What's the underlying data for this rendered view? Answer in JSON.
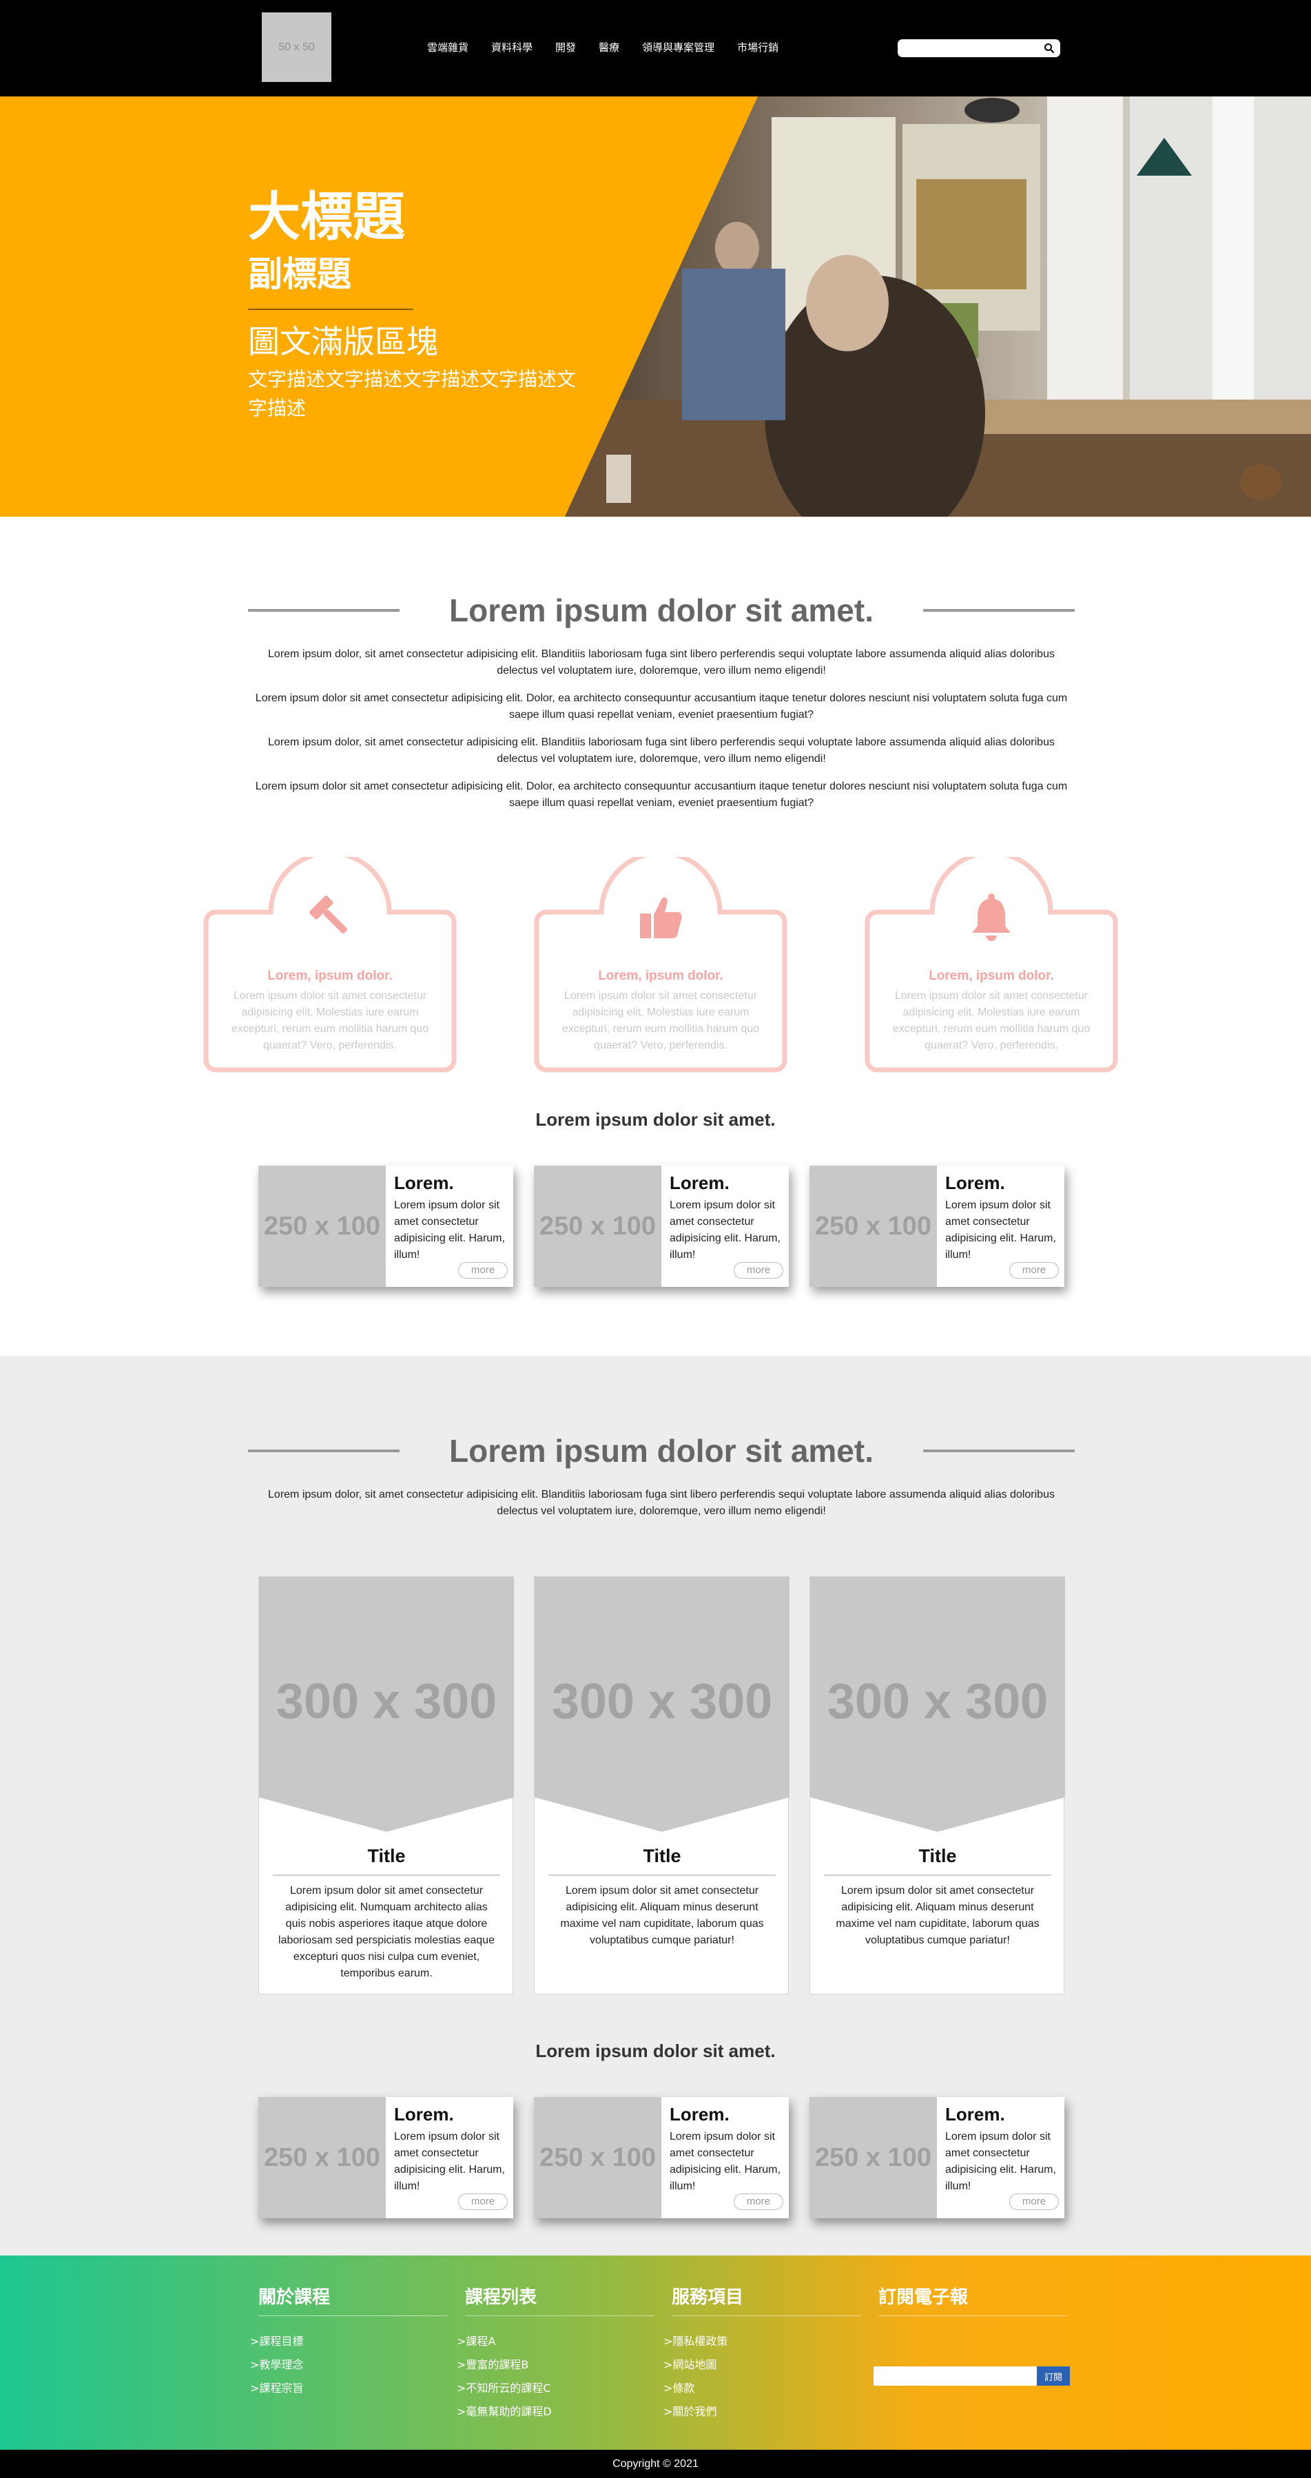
{
  "header": {
    "logo_text": "50 x 50",
    "nav": [
      "雲端雜貨",
      "資料科學",
      "開發",
      "醫療",
      "領導與專案管理",
      "市場行銷"
    ],
    "search_placeholder": ""
  },
  "hero": {
    "title": "大標題",
    "subtitle": "副標題",
    "heading": "圖文滿版區塊",
    "description": "文字描述文字描述文字描述文字描述文字描述"
  },
  "section1": {
    "title": "Lorem ipsum dolor sit amet.",
    "paragraphs": [
      "Lorem ipsum dolor, sit amet consectetur adipisicing elit. Blanditiis laboriosam fuga sint libero perferendis sequi voluptate labore assumenda aliquid alias doloribus delectus vel voluptatem iure, doloremque, vero illum nemo eligendi!",
      "Lorem ipsum dolor sit amet consectetur adipisicing elit. Dolor, ea architecto consequuntur accusantium itaque tenetur dolores nesciunt nisi voluptatem soluta fuga cum saepe illum quasi repellat veniam, eveniet praesentium fugiat?",
      "Lorem ipsum dolor, sit amet consectetur adipisicing elit. Blanditiis laboriosam fuga sint libero perferendis sequi voluptate labore assumenda aliquid alias doloribus delectus vel voluptatem iure, doloremque, vero illum nemo eligendi!",
      "Lorem ipsum dolor sit amet consectetur adipisicing elit. Dolor, ea architecto consequuntur accusantium itaque tenetur dolores nesciunt nisi voluptatem soluta fuga cum saepe illum quasi repellat veniam, eveniet praesentium fugiat?"
    ],
    "features": [
      {
        "icon": "gavel-icon",
        "title": "Lorem, ipsum dolor.",
        "desc": "Lorem ipsum dolor sit amet consectetur adipisicing elit. Molestias iure earum excepturi, rerum eum mollitia harum quo quaerat? Vero, perferendis."
      },
      {
        "icon": "thumbs-up-icon",
        "title": "Lorem, ipsum dolor.",
        "desc": "Lorem ipsum dolor sit amet consectetur adipisicing elit. Molestias iure earum excepturi, rerum eum mollitia harum quo quaerat? Vero, perferendis."
      },
      {
        "icon": "bell-icon",
        "title": "Lorem, ipsum dolor.",
        "desc": "Lorem ipsum dolor sit amet consectetur adipisicing elit. Molestias iure earum excepturi, rerum eum mollitia harum quo quaerat? Vero, perferendis."
      }
    ],
    "cards_heading": "Lorem ipsum dolor sit amet.",
    "cards": [
      {
        "thumb": "250 x 100",
        "title": "Lorem.",
        "desc": "Lorem ipsum dolor sit amet consectetur adipisicing elit. Harum, illum!",
        "more": "more"
      },
      {
        "thumb": "250 x 100",
        "title": "Lorem.",
        "desc": "Lorem ipsum dolor sit amet consectetur adipisicing elit. Harum, illum!",
        "more": "more"
      },
      {
        "thumb": "250 x 100",
        "title": "Lorem.",
        "desc": "Lorem ipsum dolor sit amet consectetur adipisicing elit. Harum, illum!",
        "more": "more"
      }
    ]
  },
  "section2": {
    "title": "Lorem ipsum dolor sit amet.",
    "paragraph": "Lorem ipsum dolor, sit amet consectetur adipisicing elit. Blanditiis laboriosam fuga sint libero perferendis sequi voluptate labore assumenda aliquid alias doloribus delectus vel voluptatem iure, doloremque, vero illum nemo eligendi!",
    "big_cards": [
      {
        "image": "300 x 300",
        "title": "Title",
        "desc": "Lorem ipsum dolor sit amet consectetur adipisicing elit. Numquam architecto alias quis nobis asperiores itaque atque dolore laboriosam sed perspiciatis molestias eaque excepturi quos nisi culpa cum eveniet, temporibus earum."
      },
      {
        "image": "300 x 300",
        "title": "Title",
        "desc": "Lorem ipsum dolor sit amet consectetur adipisicing elit. Aliquam minus deserunt maxime vel nam cupiditate, laborum quas voluptatibus cumque pariatur!"
      },
      {
        "image": "300 x 300",
        "title": "Title",
        "desc": "Lorem ipsum dolor sit amet consectetur adipisicing elit. Aliquam minus deserunt maxime vel nam cupiditate, laborum quas voluptatibus cumque pariatur!"
      }
    ],
    "cards_heading": "Lorem ipsum dolor sit amet.",
    "cards": [
      {
        "thumb": "250 x 100",
        "title": "Lorem.",
        "desc": "Lorem ipsum dolor sit amet consectetur adipisicing elit. Harum, illum!",
        "more": "more"
      },
      {
        "thumb": "250 x 100",
        "title": "Lorem.",
        "desc": "Lorem ipsum dolor sit amet consectetur adipisicing elit. Harum, illum!",
        "more": "more"
      },
      {
        "thumb": "250 x 100",
        "title": "Lorem.",
        "desc": "Lorem ipsum dolor sit amet consectetur adipisicing elit. Harum, illum!",
        "more": "more"
      }
    ]
  },
  "footer": {
    "columns": [
      {
        "title": "關於課程",
        "items": [
          ">課程目標",
          ">教學理念",
          ">課程宗旨"
        ]
      },
      {
        "title": "課程列表",
        "items": [
          ">課程A",
          ">豐富的課程B",
          ">不知所云的課程C",
          ">毫無幫助的課程D"
        ]
      },
      {
        "title": "服務項目",
        "items": [
          ">隱私權政策",
          ">網站地圖",
          ">條款",
          ">關於我們"
        ]
      },
      {
        "title": "訂閱電子報",
        "items": []
      }
    ],
    "subscribe_button": "訂閱",
    "copyright": "Copyright © 2021"
  },
  "colors": {
    "accent": "#ffab00",
    "feature_pink": "#f5a5a0",
    "gradient_start": "#1ec690",
    "subscribe_blue": "#2b62b5"
  }
}
